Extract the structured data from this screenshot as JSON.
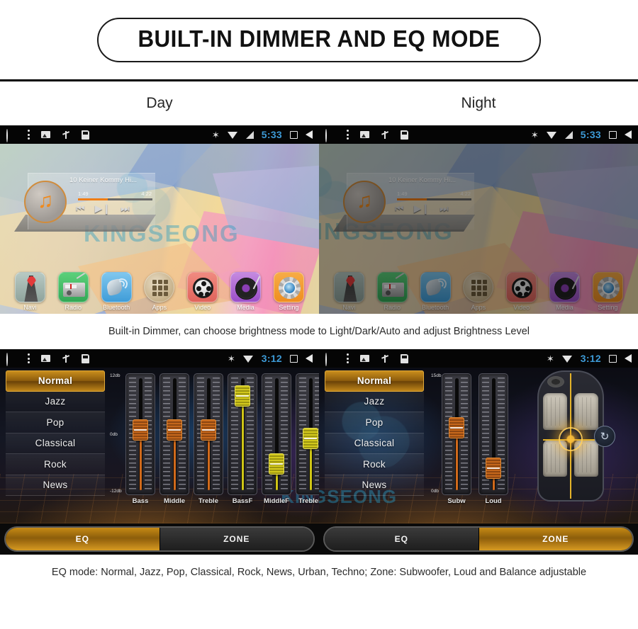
{
  "banner": {
    "title": "BUILT-IN DIMMER AND EQ MODE"
  },
  "labels": {
    "day": "Day",
    "night": "Night"
  },
  "watermark": {
    "text": "KINGSEONG",
    "short": "KIN",
    "short_left": "GSEONG"
  },
  "statusbar": {
    "left_icons": [
      "home-circle-icon",
      "menu-dots-icon",
      "image-icon",
      "usb-icon",
      "sdcard-icon"
    ],
    "right_icons": [
      "bluetooth-icon",
      "wifi-icon",
      "signal-icon"
    ],
    "nav_icons": [
      "recents-square-icon",
      "back-triangle-icon"
    ],
    "bluetooth_glyph": "✶",
    "time_home": "5:33",
    "time_eq": "3:12"
  },
  "home": {
    "player": {
      "track_title": "10 Keiner Kommy Hi...",
      "elapsed": "1:49",
      "duration": "4:22",
      "progress_percent": 40,
      "prev_glyph": "⏮",
      "play_pause_glyph": "▶❙",
      "next_glyph": "⏭",
      "album_art_icon": "music-note-icon",
      "album_note_glyph": "♫"
    },
    "dock": [
      {
        "label": "Navi",
        "icon": "navi-icon"
      },
      {
        "label": "Radio",
        "icon": "radio-icon"
      },
      {
        "label": "Bluetooth",
        "icon": "bluetooth-phone-icon"
      },
      {
        "label": "Apps",
        "icon": "apps-grid-icon"
      },
      {
        "label": "Video",
        "icon": "video-reel-icon"
      },
      {
        "label": "Media",
        "icon": "media-turntable-icon"
      },
      {
        "label": "Setting",
        "icon": "settings-gear-icon"
      }
    ]
  },
  "captions": {
    "dimmer": "Built-in Dimmer, can choose brightness mode to Light/Dark/Auto and adjust Brightness Level",
    "eq": "EQ mode: Normal, Jazz, Pop, Classical, Rock, News, Urban, Techno; Zone: Subwoofer, Loud and Balance adjustable"
  },
  "eq_panel": {
    "presets": [
      {
        "label": "Normal",
        "active": true
      },
      {
        "label": "Jazz",
        "active": false
      },
      {
        "label": "Pop",
        "active": false
      },
      {
        "label": "Classical",
        "active": false
      },
      {
        "label": "Rock",
        "active": false
      },
      {
        "label": "News",
        "active": false
      }
    ],
    "scale": {
      "top": "12db",
      "mid": "0db",
      "bottom": "-12db"
    },
    "faders": [
      {
        "label": "Bass",
        "value_percent": 50,
        "color": "orange"
      },
      {
        "label": "Middle",
        "value_percent": 50,
        "color": "orange"
      },
      {
        "label": "Treble",
        "value_percent": 50,
        "color": "orange"
      },
      {
        "label": "BassF",
        "value_percent": 78,
        "color": "yellow"
      },
      {
        "label": "MiddleF",
        "value_percent": 22,
        "color": "yellow"
      },
      {
        "label": "TrebleF",
        "value_percent": 43,
        "color": "yellow"
      }
    ],
    "toggle": [
      {
        "label": "EQ",
        "active": true
      },
      {
        "label": "ZONE",
        "active": false
      }
    ]
  },
  "zone_panel": {
    "presets": [
      {
        "label": "Normal",
        "active": true
      },
      {
        "label": "Jazz",
        "active": false
      },
      {
        "label": "Pop",
        "active": false
      },
      {
        "label": "Classical",
        "active": false
      },
      {
        "label": "Rock",
        "active": false
      },
      {
        "label": "News",
        "active": false
      }
    ],
    "scale": {
      "top": "15db",
      "bottom": "0db"
    },
    "faders": [
      {
        "label": "Subw",
        "value_percent": 52,
        "color": "orange"
      },
      {
        "label": "Loud",
        "value_percent": 18,
        "color": "orange"
      }
    ],
    "balance": {
      "icon": "car-seats-balance-icon",
      "reset_icon": "reset-icon",
      "reset_glyph": "↻"
    },
    "toggle": [
      {
        "label": "EQ",
        "active": false
      },
      {
        "label": "ZONE",
        "active": true
      }
    ]
  }
}
